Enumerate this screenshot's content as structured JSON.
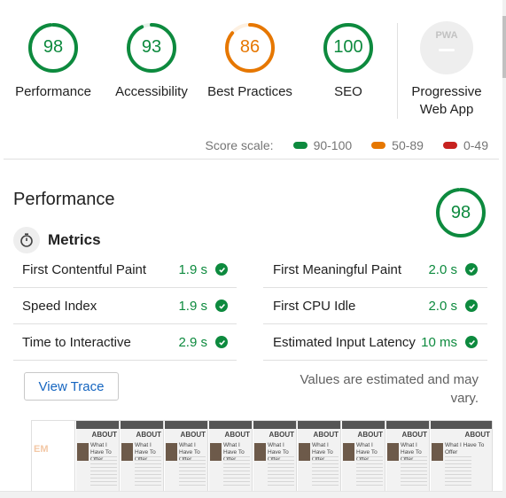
{
  "gauges": [
    {
      "score": "98",
      "label": "Performance",
      "color": "#0d8a3e"
    },
    {
      "score": "93",
      "label": "Accessibility",
      "color": "#0d8a3e"
    },
    {
      "score": "86",
      "label": "Best Practices",
      "color": "#e67700"
    },
    {
      "score": "100",
      "label": "SEO",
      "color": "#0d8a3e"
    }
  ],
  "pwa": {
    "badge_text": "PWA",
    "label_line1": "Progressive",
    "label_line2": "Web App"
  },
  "scale": {
    "title": "Score scale:",
    "ranges": [
      {
        "label": "90-100",
        "color": "#0d8a3e"
      },
      {
        "label": "50-89",
        "color": "#e67700"
      },
      {
        "label": "0-49",
        "color": "#c7221f"
      }
    ]
  },
  "performance": {
    "title": "Performance",
    "score": "98",
    "metrics_title": "Metrics",
    "metrics_left": [
      {
        "label": "First Contentful Paint",
        "value": "1.9 s"
      },
      {
        "label": "Speed Index",
        "value": "1.9 s"
      },
      {
        "label": "Time to Interactive",
        "value": "2.9 s"
      }
    ],
    "metrics_right": [
      {
        "label": "First Meaningful Paint",
        "value": "2.0 s"
      },
      {
        "label": "First CPU Idle",
        "value": "2.0 s"
      },
      {
        "label": "Estimated Input Latency",
        "value": "10 ms"
      }
    ],
    "view_trace_label": "View Trace",
    "note": "Values are estimated and may vary."
  },
  "filmstrip": {
    "first_text": "EM",
    "frame_heading": "ABOUT",
    "frame_subtext": "What I Have To Offer"
  }
}
